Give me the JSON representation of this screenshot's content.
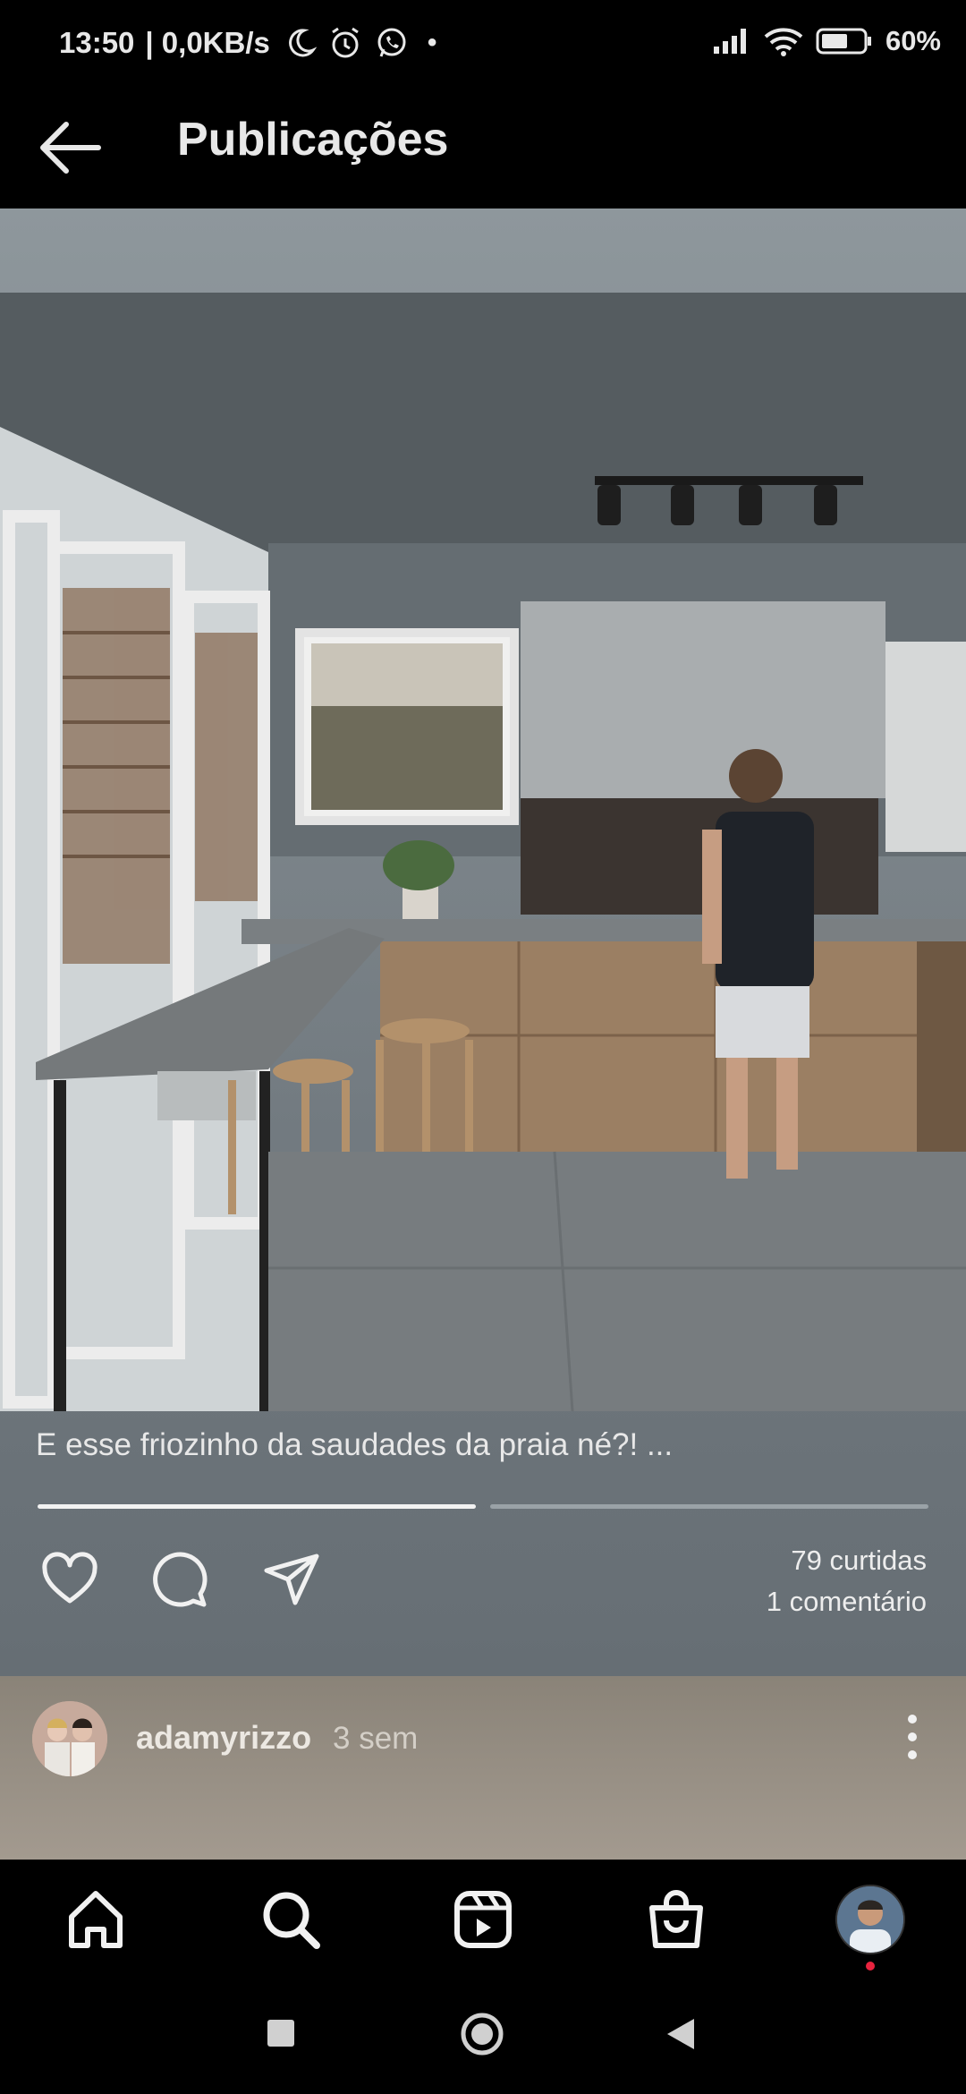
{
  "status_bar": {
    "time": "13:50",
    "speed": "| 0,0KB/s",
    "battery": "60%"
  },
  "header": {
    "title": "Publicações"
  },
  "post": {
    "caption": "E esse friozinho da saudades da praia né?! ...",
    "likes": "79 curtidas",
    "comments": "1 comentário",
    "carousel_index": 1,
    "carousel_total": 2
  },
  "author": {
    "username": "adamyrizzo",
    "time": "3 sem"
  },
  "icons": {
    "back": "arrow-left-icon",
    "like": "heart-icon",
    "comment": "comment-bubble-icon",
    "share": "paper-plane-icon",
    "more": "vertical-ellipsis-icon",
    "nav": [
      "home-icon",
      "search-icon",
      "reels-icon",
      "shop-bag-icon",
      "profile-avatar"
    ]
  },
  "colors": {
    "notification_dot": "#e8233e"
  }
}
